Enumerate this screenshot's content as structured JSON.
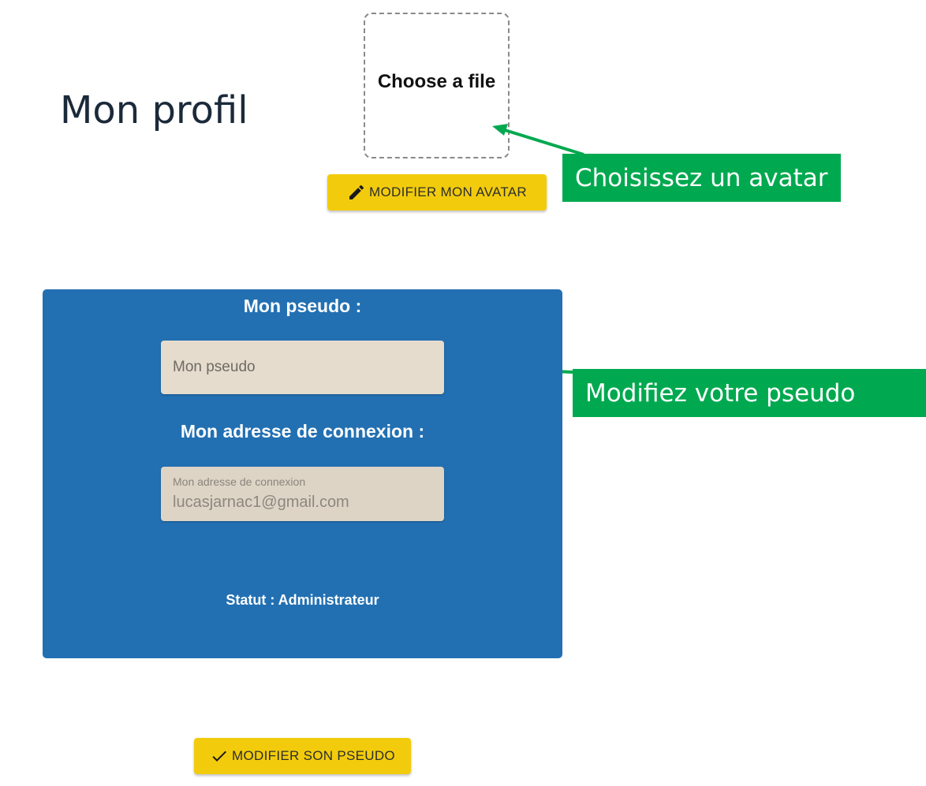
{
  "page": {
    "title": "Mon profil"
  },
  "avatar": {
    "dropzone_label": "Choose a file",
    "button_label": "MODIFIER MON AVATAR",
    "button_icon": "pencil-icon"
  },
  "annotations": {
    "avatar_hint": "Choisissez un avatar",
    "pseudo_hint": "Modifiez votre pseudo",
    "color": "#00a94f"
  },
  "profile_card": {
    "background": "#2270b2",
    "pseudo_heading": "Mon pseudo :",
    "pseudo_placeholder": "Mon pseudo",
    "pseudo_value": "",
    "email_heading": "Mon adresse de connexion :",
    "email_label": "Mon adresse de connexion",
    "email_value": "lucasjarnac1@gmail.com",
    "status": "Statut : Administrateur"
  },
  "submit": {
    "button_label": "MODIFIER SON PSEUDO",
    "button_icon": "check-icon"
  },
  "colors": {
    "button_yellow": "#f2cc0c",
    "title_text": "#1b2a3a"
  }
}
